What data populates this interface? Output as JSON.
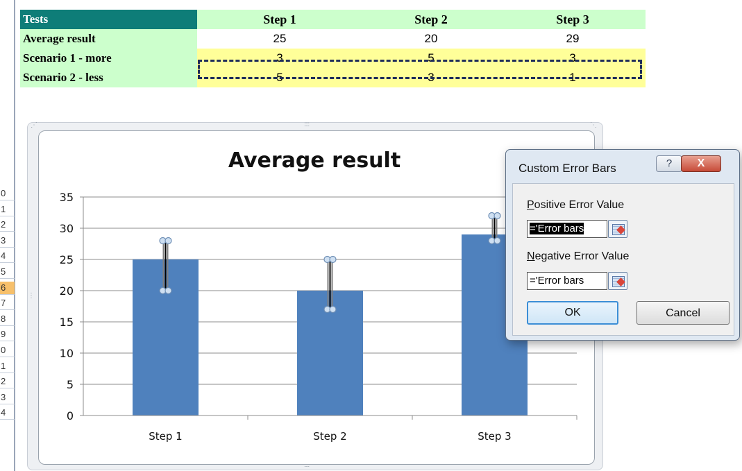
{
  "sheet": {
    "header": {
      "label": "Tests",
      "steps": [
        "Step 1",
        "Step 2",
        "Step 3"
      ]
    },
    "rows": [
      {
        "label": "Average result",
        "values": [
          "25",
          "20",
          "29"
        ]
      },
      {
        "label": "Scenario 1 - more",
        "values": [
          "3",
          "5",
          "3"
        ]
      },
      {
        "label": "Scenario 2 - less",
        "values": [
          "5",
          "3",
          "1"
        ]
      }
    ]
  },
  "row_numbers": [
    "0",
    "1",
    "2",
    "3",
    "4",
    "5",
    "6",
    "7",
    "8",
    "9",
    "0",
    "1",
    "2",
    "3",
    "4"
  ],
  "active_row": "6",
  "chart_data": {
    "type": "bar",
    "title": "Average result",
    "categories": [
      "Step 1",
      "Step 2",
      "Step 3"
    ],
    "values": [
      25,
      20,
      29
    ],
    "error_plus": [
      3,
      5,
      3
    ],
    "error_minus": [
      5,
      3,
      1
    ],
    "ylim": [
      0,
      35
    ],
    "yticks": [
      0,
      5,
      10,
      15,
      20,
      25,
      30,
      35
    ],
    "grid": true,
    "bar_color": "#4f81bd"
  },
  "dialog": {
    "title": "Custom Error Bars",
    "help_glyph": "?",
    "close_glyph": "X",
    "positive_label_accel": "P",
    "positive_label_rest": "ositive Error Value",
    "positive_value": "='Error bars",
    "negative_label_accel": "N",
    "negative_label_rest": "egative Error Value",
    "negative_value": "='Error bars",
    "ok_label": "OK",
    "cancel_label": "Cancel"
  }
}
